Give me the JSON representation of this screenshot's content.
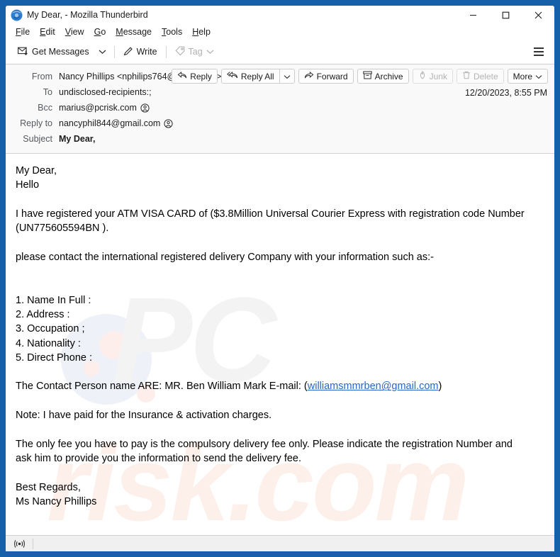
{
  "window": {
    "title": "My Dear, - Mozilla Thunderbird",
    "logo_icon": "thunderbird-logo-icon",
    "minimize_label": "Minimize",
    "maximize_label": "Maximize",
    "close_label": "Close",
    "frame_color": "#1560a8"
  },
  "menubar": {
    "items": [
      {
        "label": "File",
        "accel": "F"
      },
      {
        "label": "Edit",
        "accel": "E"
      },
      {
        "label": "View",
        "accel": "V"
      },
      {
        "label": "Go",
        "accel": "G"
      },
      {
        "label": "Message",
        "accel": "M"
      },
      {
        "label": "Tools",
        "accel": "T"
      },
      {
        "label": "Help",
        "accel": "H"
      }
    ]
  },
  "toolbar": {
    "get_messages_label": "Get Messages",
    "get_messages_icon": "envelope-download-icon",
    "get_messages_chevron_icon": "chevron-down-icon",
    "write_label": "Write",
    "write_icon": "pencil-icon",
    "tag_label": "Tag",
    "tag_icon": "tag-icon",
    "tag_chevron_icon": "chevron-down-icon",
    "tag_disabled": true,
    "app_menu_icon": "hamburger-menu-icon"
  },
  "message_header": {
    "fields": [
      {
        "label": "From",
        "value": "Nancy Phillips <nphilips764@gmail.com>",
        "has_contact_icon": true,
        "bold": false
      },
      {
        "label": "To",
        "value": "undisclosed-recipients:;",
        "has_contact_icon": false,
        "bold": false
      },
      {
        "label": "Bcc",
        "value": "marius@pcrisk.com",
        "has_contact_icon": true,
        "bold": false
      },
      {
        "label": "Reply to",
        "value": "nancyphil844@gmail.com",
        "has_contact_icon": true,
        "bold": false
      },
      {
        "label": "Subject",
        "value": "My Dear,",
        "has_contact_icon": false,
        "bold": true
      }
    ],
    "date": "12/20/2023, 8:55 PM",
    "actions": {
      "reply_label": "Reply",
      "reply_icon": "reply-arrow-icon",
      "reply_all_label": "Reply All",
      "reply_all_icon": "reply-all-arrow-icon",
      "reply_all_chevron_icon": "chevron-down-icon",
      "forward_label": "Forward",
      "forward_icon": "forward-arrow-icon",
      "archive_label": "Archive",
      "archive_icon": "archive-box-icon",
      "junk_label": "Junk",
      "junk_icon": "flame-icon",
      "junk_disabled": true,
      "delete_label": "Delete",
      "delete_icon": "trash-can-icon",
      "delete_disabled": true,
      "more_label": "More",
      "more_chevron_icon": "chevron-down-icon"
    }
  },
  "message_body": {
    "watermark_top": "PC",
    "watermark_bottom": "risk.com",
    "lines": [
      {
        "type": "text",
        "text": "My Dear,"
      },
      {
        "type": "text",
        "text": "Hello"
      },
      {
        "type": "blank"
      },
      {
        "type": "text",
        "text": "I have registered your ATM VISA CARD of ($3.8Million Universal Courier Express with registration code Number"
      },
      {
        "type": "text",
        "text": "(UN775605594BN )."
      },
      {
        "type": "blank"
      },
      {
        "type": "text",
        "text": "please contact the international registered delivery Company with your information such as:-"
      },
      {
        "type": "blank"
      },
      {
        "type": "blank"
      },
      {
        "type": "text",
        "text": "1. Name In Full :"
      },
      {
        "type": "text",
        "text": "2. Address :"
      },
      {
        "type": "text",
        "text": "3. Occupation ;"
      },
      {
        "type": "text",
        "text": "4. Nationality :"
      },
      {
        "type": "text",
        "text": "5. Direct Phone :"
      },
      {
        "type": "blank"
      },
      {
        "type": "link_line",
        "before": "The Contact Person name ARE: MR. Ben William Mark   E-mail: (",
        "link": "williamsmmrben@gmail.com",
        "after": ")"
      },
      {
        "type": "blank"
      },
      {
        "type": "text",
        "text": "Note: I have paid for the Insurance & activation charges."
      },
      {
        "type": "blank"
      },
      {
        "type": "text",
        "text": "The only fee you have to pay is the compulsory delivery fee only. Please indicate the registration Number and"
      },
      {
        "type": "text",
        "text": "ask him to provide you the information to send the delivery fee."
      },
      {
        "type": "blank"
      },
      {
        "type": "text",
        "text": "Best Regards,"
      },
      {
        "type": "text",
        "text": "Ms  Nancy Phillips"
      }
    ]
  },
  "statusbar": {
    "connection_icon": "broadcast-signal-icon",
    "message": ""
  }
}
